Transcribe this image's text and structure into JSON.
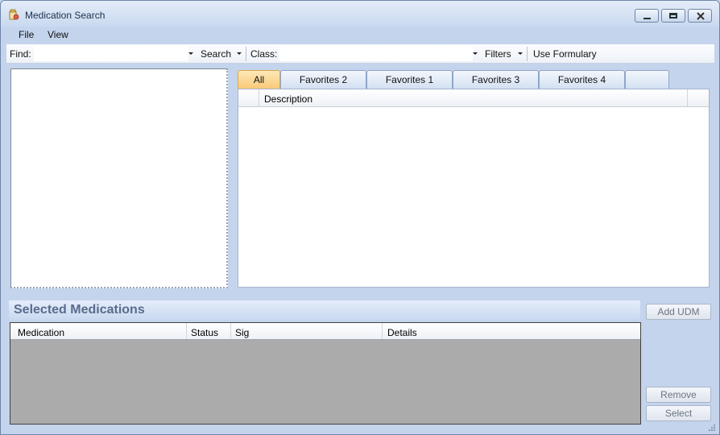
{
  "window": {
    "title": "Medication Search"
  },
  "menu": {
    "file": "File",
    "view": "View"
  },
  "toolbar": {
    "find_label": "Find:",
    "find_value": "",
    "search_label": "Search",
    "class_label": "Class:",
    "class_value": "",
    "filters_label": "Filters",
    "use_formulary_label": "Use Formulary"
  },
  "tabs": [
    {
      "label": "All",
      "active": true
    },
    {
      "label": "Favorites 2",
      "active": false
    },
    {
      "label": "Favorites 1",
      "active": false
    },
    {
      "label": "Favorites 3",
      "active": false
    },
    {
      "label": "Favorites 4",
      "active": false
    },
    {
      "label": "",
      "active": false
    }
  ],
  "results_grid": {
    "columns": [
      "Description"
    ],
    "rows": []
  },
  "selected": {
    "title": "Selected Medications",
    "columns": [
      "Medication",
      "Status",
      "Sig",
      "Details"
    ],
    "rows": []
  },
  "buttons": {
    "add_udm": "Add UDM",
    "remove": "Remove",
    "select": "Select"
  },
  "icons": {
    "app": "medication-app-icon",
    "minimize": "minimize-icon",
    "maximize": "maximize-icon",
    "close": "close-icon",
    "dropdown": "chevron-down-icon",
    "grip": "resize-grip-icon"
  }
}
